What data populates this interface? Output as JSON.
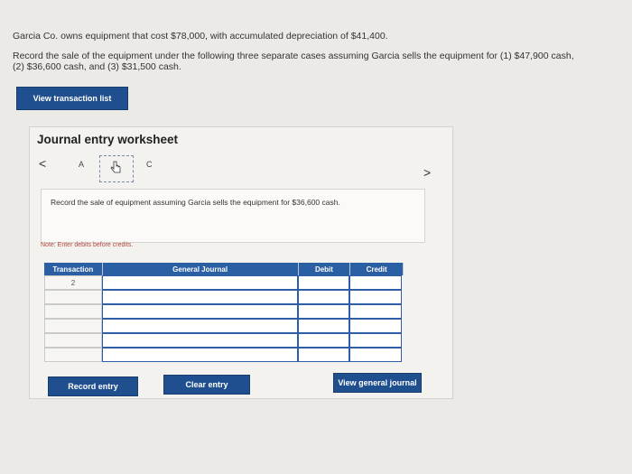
{
  "problem": {
    "line1": "Garcia Co. owns equipment that cost $78,000, with accumulated depreciation of $41,400.",
    "line2": "Record the sale of the equipment under the following three separate cases assuming Garcia sells the equipment for (1) $47,900 cash,",
    "line3": "(2) $36,600 cash, and (3) $31,500 cash."
  },
  "view_transaction_list_label": "View transaction list",
  "worksheet": {
    "title": "Journal entry worksheet",
    "tabs": [
      "A",
      "B",
      "C"
    ],
    "prev_glyph": "<",
    "next_glyph": ">",
    "instruction": "Record the sale of equipment assuming Garcia sells the equipment for $36,600 cash.",
    "note": "Note: Enter debits before credits.",
    "columns": [
      "Transaction",
      "General Journal",
      "Debit",
      "Credit"
    ],
    "rows": [
      {
        "transaction": "2",
        "account": "",
        "debit": "",
        "credit": ""
      },
      {
        "transaction": "",
        "account": "",
        "debit": "",
        "credit": ""
      },
      {
        "transaction": "",
        "account": "",
        "debit": "",
        "credit": ""
      },
      {
        "transaction": "",
        "account": "",
        "debit": "",
        "credit": ""
      },
      {
        "transaction": "",
        "account": "",
        "debit": "",
        "credit": ""
      },
      {
        "transaction": "",
        "account": "",
        "debit": "",
        "credit": ""
      }
    ]
  },
  "buttons": {
    "record_entry": "Record entry",
    "clear_entry": "Clear entry",
    "view_general_journal": "View general journal"
  },
  "colors": {
    "primary_button": "#1f4f8e",
    "table_header": "#2b5fa4",
    "note_text": "#b5473c"
  }
}
